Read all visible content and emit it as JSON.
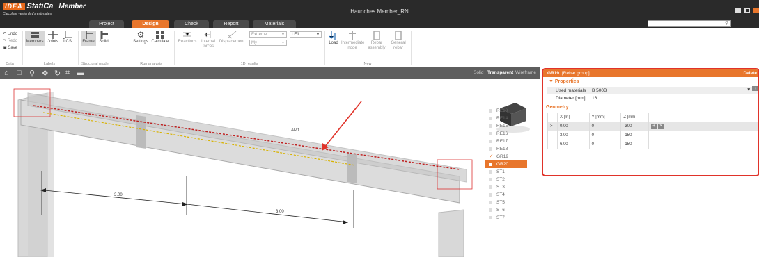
{
  "app": {
    "logo_brand": "IDEA",
    "logo_product": "StatiCa",
    "logo_module": "Member",
    "tagline": "Calculate yesterday's estimates",
    "window_title": "Haunches Member_RN",
    "accent": "#e8762c"
  },
  "tabs": [
    "Project",
    "Design",
    "Check",
    "Report",
    "Materials"
  ],
  "active_tab": "Design",
  "ribbon": {
    "undo": "Undo",
    "redo": "Redo",
    "save": "Save",
    "members": "Members",
    "joints": "Joints",
    "lcs": "LCS",
    "frame": "Frame",
    "solid": "Solid",
    "settings": "Settings",
    "calculate": "Calculate",
    "reactions": "Reactions",
    "internal_forces": "Internal forces",
    "displacement": "Displacement",
    "extreme": "Extreme",
    "my": "My",
    "le": "LE1",
    "load": "Load",
    "intermediate_node": "Intermediate node",
    "rebar_assembly": "Rebar assembly",
    "general_rebar": "General rebar",
    "groups": {
      "data": "Data",
      "labels": "Labels",
      "structural_model": "Structural model",
      "run_analysis": "Run analysis",
      "results_1d": "1D results",
      "new": "New"
    }
  },
  "view": {
    "modes": [
      "Solid",
      "Transparent",
      "Wireframe"
    ],
    "active_mode": "Transparent",
    "dim1": "3.00",
    "dim2": "3.00",
    "member_label": "AM1"
  },
  "parts": [
    {
      "name": "RE13",
      "state": "normal"
    },
    {
      "name": "RE14",
      "state": "normal"
    },
    {
      "name": "RE15",
      "state": "normal"
    },
    {
      "name": "RE16",
      "state": "normal"
    },
    {
      "name": "RE17",
      "state": "normal"
    },
    {
      "name": "RE18",
      "state": "normal"
    },
    {
      "name": "GR19",
      "state": "check"
    },
    {
      "name": "GR20",
      "state": "selected"
    },
    {
      "name": "ST1",
      "state": "normal"
    },
    {
      "name": "ST2",
      "state": "normal"
    },
    {
      "name": "ST3",
      "state": "normal"
    },
    {
      "name": "ST4",
      "state": "normal"
    },
    {
      "name": "ST5",
      "state": "normal"
    },
    {
      "name": "ST6",
      "state": "normal"
    },
    {
      "name": "ST7",
      "state": "normal"
    }
  ],
  "panel": {
    "header_id": "GR19",
    "header_type": "[Rebar group]",
    "delete": "Delete",
    "properties": "Properties",
    "used_materials_label": "Used materials",
    "used_materials_value": "B 500B",
    "diameter_label": "Diameter [mm]",
    "diameter_value": "16",
    "geometry": "Geometry",
    "columns": [
      "X [m]",
      "Y [mm]",
      "Z [mm]"
    ],
    "rows": [
      [
        "0.00",
        "0",
        "-300"
      ],
      [
        "3.00",
        "0",
        "-150"
      ],
      [
        "6.00",
        "0",
        "-150"
      ]
    ]
  }
}
